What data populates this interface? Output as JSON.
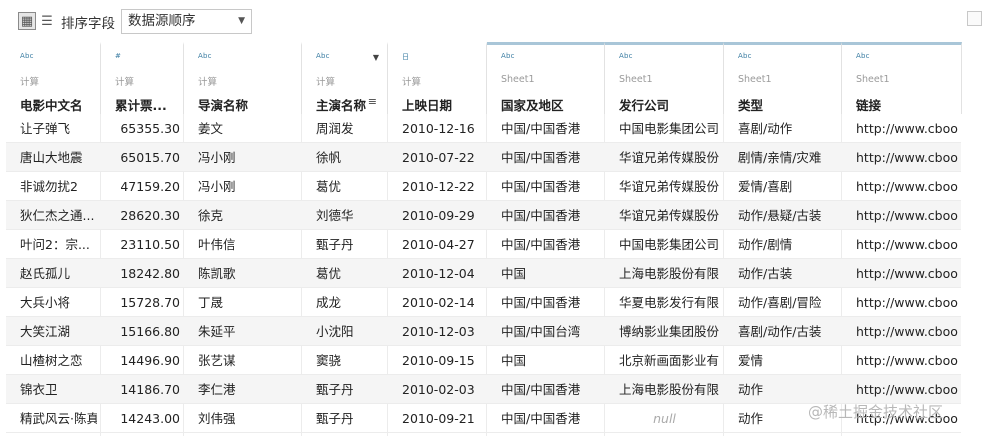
{
  "toolbar": {
    "sort_label": "排序字段",
    "sort_value": "数据源顺序",
    "grid_icon": "grid-view-icon",
    "list_icon": "list-view-icon"
  },
  "columns": [
    {
      "type": "Abc",
      "source": "计算",
      "name": "电影中文名"
    },
    {
      "type": "#",
      "source": "计算",
      "name": "累计票..."
    },
    {
      "type": "Abc",
      "source": "计算",
      "name": "导演名称"
    },
    {
      "type": "Abc",
      "source": "计算",
      "name": "主演名称"
    },
    {
      "type": "日",
      "source": "计算",
      "name": "上映日期"
    },
    {
      "type": "Abc",
      "source": "Sheet1",
      "name": "国家及地区"
    },
    {
      "type": "Abc",
      "source": "Sheet1",
      "name": "发行公司"
    },
    {
      "type": "Abc",
      "source": "Sheet1",
      "name": "类型"
    },
    {
      "type": "Abc",
      "source": "Sheet1",
      "name": "链接"
    }
  ],
  "rows": [
    [
      "让子弹飞",
      "65355.30",
      "姜文",
      "周润发",
      "2010-12-16",
      "中国/中国香港",
      "中国电影集团公司",
      "喜剧/动作",
      "http://www.cboo..."
    ],
    [
      "唐山大地震",
      "65015.70",
      "冯小刚",
      "徐帆",
      "2010-07-22",
      "中国/中国香港",
      "华谊兄弟传媒股份...",
      "剧情/亲情/灾难",
      "http://www.cboo..."
    ],
    [
      "非诚勿扰2",
      "47159.20",
      "冯小刚",
      "葛优",
      "2010-12-22",
      "中国/中国香港",
      "华谊兄弟传媒股份...",
      "爱情/喜剧",
      "http://www.cboo..."
    ],
    [
      "狄仁杰之通...",
      "28620.30",
      "徐克",
      "刘德华",
      "2010-09-29",
      "中国/中国香港",
      "华谊兄弟传媒股份...",
      "动作/悬疑/古装",
      "http://www.cboo..."
    ],
    [
      "叶问2：宗...",
      "23110.50",
      "叶伟信",
      "甄子丹",
      "2010-04-27",
      "中国/中国香港",
      "中国电影集团公司",
      "动作/剧情",
      "http://www.cboo..."
    ],
    [
      "赵氏孤儿",
      "18242.80",
      "陈凯歌",
      "葛优",
      "2010-12-04",
      "中国",
      "上海电影股份有限...",
      "动作/古装",
      "http://www.cboo..."
    ],
    [
      "大兵小将",
      "15728.70",
      "丁晟",
      "成龙",
      "2010-02-14",
      "中国/中国香港",
      "华夏电影发行有限...",
      "动作/喜剧/冒险",
      "http://www.cboo..."
    ],
    [
      "大笑江湖",
      "15166.80",
      "朱延平",
      "小沈阳",
      "2010-12-03",
      "中国/中国台湾",
      "博纳影业集团股份...",
      "喜剧/动作/古装",
      "http://www.cboo..."
    ],
    [
      "山楂树之恋",
      "14496.90",
      "张艺谋",
      "窦骁",
      "2010-09-15",
      "中国",
      "北京新画面影业有...",
      "爱情",
      "http://www.cboo..."
    ],
    [
      "锦衣卫",
      "14186.70",
      "李仁港",
      "甄子丹",
      "2010-02-03",
      "中国/中国香港",
      "上海电影股份有限...",
      "动作",
      "http://www.cboo..."
    ],
    [
      "精武风云·陈真",
      "14243.00",
      "刘伟强",
      "甄子丹",
      "2010-09-21",
      "中国/中国香港",
      "null",
      "动作",
      "http://www.cboo..."
    ]
  ],
  "watermark": "@稀土掘金技术社区",
  "colors": {
    "accent_bar": "#a9c6d8",
    "type_icon": "#3e7fa4"
  }
}
